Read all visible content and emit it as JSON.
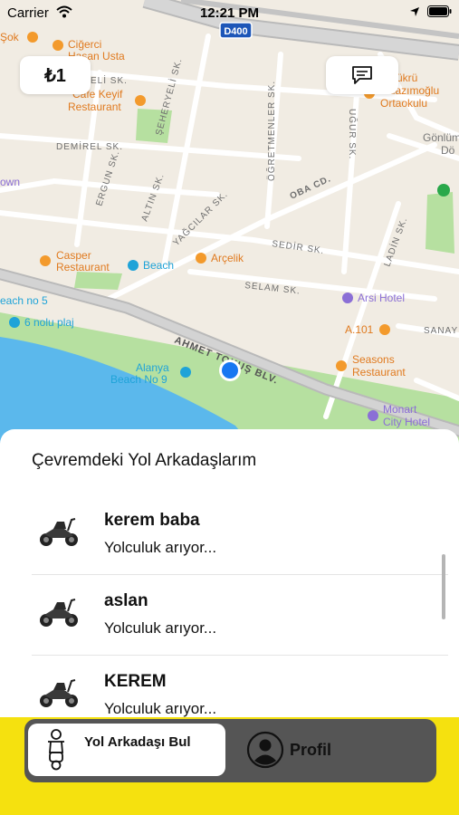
{
  "status_bar": {
    "carrier": "Carrier",
    "time": "12:21 PM"
  },
  "map": {
    "road_shield": "D400",
    "labels": {
      "sok": "Şok",
      "cigerci": [
        "Ciğerci",
        "Hasan Usta"
      ],
      "dilek_sk": "ELİ SK.",
      "cafe_keyif": [
        "Cafe Keyif",
        "Restaurant"
      ],
      "seheryeli_sk": "ŞEHERYELİ SK.",
      "ogretmenler_sk": "ÖĞRETMENLER SK.",
      "ugur_sk": "UĞUR SK.",
      "school": [
        "Şükrü",
        "Yalazımoğlu",
        "Ortaokulu"
      ],
      "gonlum": [
        "Gönlüm",
        "Dö"
      ],
      "demirel_sk": "DEMİREL SK.",
      "ergun_sk": "ERGUN SK.",
      "altin_sk": "ALTIN SK.",
      "yagcilar_sk": "YAĞCILAR SK.",
      "oba_cd": "OBA CD.",
      "sedir_sk": "SEDİR SK.",
      "ladin_sk": "LADİN SK.",
      "selam_sk": "SELAM SK.",
      "town": "own",
      "casper": [
        "Casper",
        "Restaurant"
      ],
      "beach": "Beach",
      "arcelik": "Arçelik",
      "arsi_hotel": "Arsi Hotel",
      "beach_no5": "each no 5",
      "plaj6": "6 nolu plaj",
      "a101": "A.101",
      "sanayi": "SANAYİ",
      "boulevard": "AHMET TOKUŞ BLV.",
      "alanya_beach": [
        "Alanya",
        "Beach No 9"
      ],
      "seasons": [
        "Seasons",
        "Restaurant"
      ],
      "monart": [
        "Monart",
        "City Hotel"
      ]
    }
  },
  "top_buttons": {
    "balance": "₺1",
    "messages_icon": "chat-icon"
  },
  "panel": {
    "title": "Çevremdeki Yol Arkadaşlarım",
    "items": [
      {
        "name": "kerem baba",
        "status": "Yolculuk arıyor...",
        "icon": "scooter-icon"
      },
      {
        "name": "aslan",
        "status": "Yolculuk arıyor...",
        "icon": "scooter-icon"
      },
      {
        "name": "KEREM",
        "status": "Yolculuk arıyor...",
        "icon": "scooter-icon"
      }
    ]
  },
  "tabs": [
    {
      "label": "Yol Arkadaşı Bul",
      "icon": "rider-icon",
      "active": true
    },
    {
      "label": "Profil",
      "icon": "profile-icon",
      "active": false
    }
  ],
  "colors": {
    "accent_yellow": "#f5e10f",
    "tabbar_gray": "#555555",
    "location_blue": "#1877f2",
    "poi_orange": "#f39a2c",
    "poi_purple": "#8b6fd6",
    "poi_teal": "#1fa3d8",
    "water": "#5bb8ec",
    "park": "#a9dc92"
  }
}
